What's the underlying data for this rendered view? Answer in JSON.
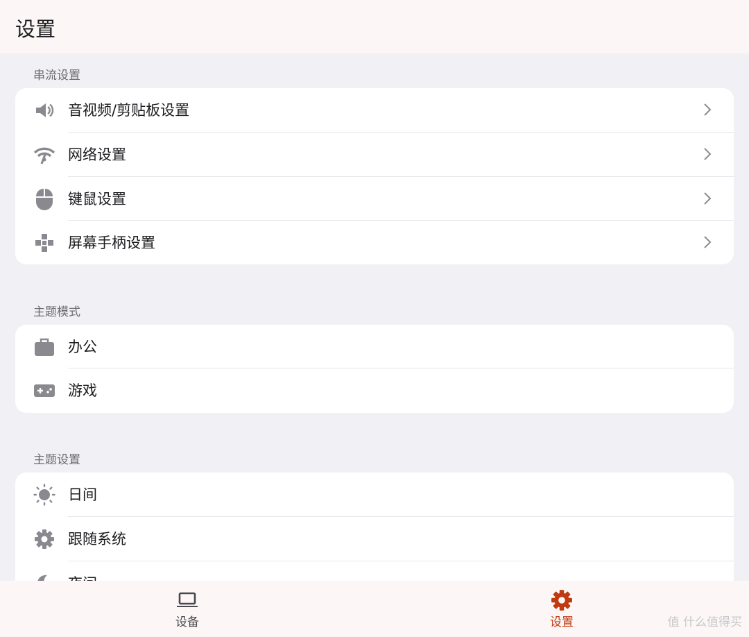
{
  "header": {
    "title": "设置"
  },
  "sections": [
    {
      "label": "串流设置",
      "items": [
        {
          "label": "音视频/剪贴板设置",
          "icon": "volume-icon"
        },
        {
          "label": "网络设置",
          "icon": "wifi-icon"
        },
        {
          "label": "键鼠设置",
          "icon": "mouse-icon"
        },
        {
          "label": "屏幕手柄设置",
          "icon": "gamepad-icon"
        }
      ]
    },
    {
      "label": "主题模式",
      "items": [
        {
          "label": "办公",
          "icon": "briefcase-icon"
        },
        {
          "label": "游戏",
          "icon": "game-controller-icon"
        }
      ]
    },
    {
      "label": "主题设置",
      "items": [
        {
          "label": "日间",
          "icon": "sun-icon"
        },
        {
          "label": "跟随系统",
          "icon": "gear-icon"
        },
        {
          "label": "夜间",
          "icon": "moon-icon"
        }
      ]
    }
  ],
  "bottom_nav": {
    "devices_label": "设备",
    "settings_label": "设置",
    "active": "settings"
  },
  "watermark": "值 什么值得买",
  "colors": {
    "accent": "#c0390f",
    "icon": "#8a898f",
    "nav_inactive": "#4a494f"
  }
}
